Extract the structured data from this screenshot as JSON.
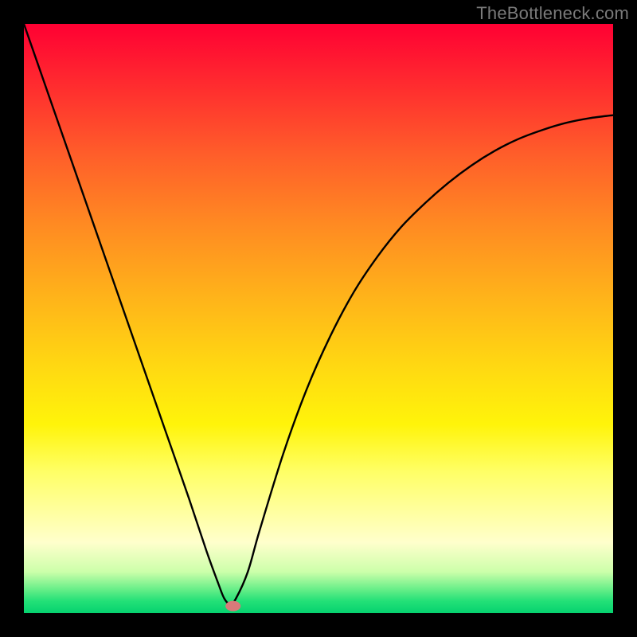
{
  "watermark": "TheBottleneck.com",
  "chart_data": {
    "type": "line",
    "title": "",
    "xlabel": "",
    "ylabel": "",
    "xlim": [
      0,
      100
    ],
    "ylim": [
      0,
      100
    ],
    "series": [
      {
        "name": "curve",
        "x": [
          0,
          4,
          8,
          12,
          16,
          20,
          24,
          28,
          31,
          33,
          34,
          35,
          36,
          38,
          40,
          44,
          48,
          52,
          56,
          60,
          64,
          68,
          72,
          76,
          80,
          84,
          88,
          92,
          96,
          100
        ],
        "y": [
          100,
          88.5,
          77,
          65.5,
          54,
          42.5,
          31,
          19.5,
          10.5,
          5,
          2.5,
          1.5,
          2.5,
          7,
          14,
          27,
          38,
          47,
          54.5,
          60.5,
          65.5,
          69.5,
          73,
          76,
          78.5,
          80.5,
          82,
          83.2,
          84,
          84.5
        ]
      }
    ],
    "marker": {
      "x": 35.5,
      "y": 1.2,
      "color": "#d77a7a"
    },
    "gradient_stops": [
      {
        "pos": 0,
        "color": "#ff0033"
      },
      {
        "pos": 10,
        "color": "#ff2a2f"
      },
      {
        "pos": 22,
        "color": "#ff5d2a"
      },
      {
        "pos": 34,
        "color": "#ff8a22"
      },
      {
        "pos": 46,
        "color": "#ffb21a"
      },
      {
        "pos": 58,
        "color": "#ffd812"
      },
      {
        "pos": 68,
        "color": "#fff40a"
      },
      {
        "pos": 76,
        "color": "#ffff66"
      },
      {
        "pos": 82,
        "color": "#ffff99"
      },
      {
        "pos": 88,
        "color": "#ffffcc"
      },
      {
        "pos": 93,
        "color": "#ccffaa"
      },
      {
        "pos": 96,
        "color": "#66ee88"
      },
      {
        "pos": 98,
        "color": "#22e077"
      },
      {
        "pos": 100,
        "color": "#05d26f"
      }
    ]
  }
}
